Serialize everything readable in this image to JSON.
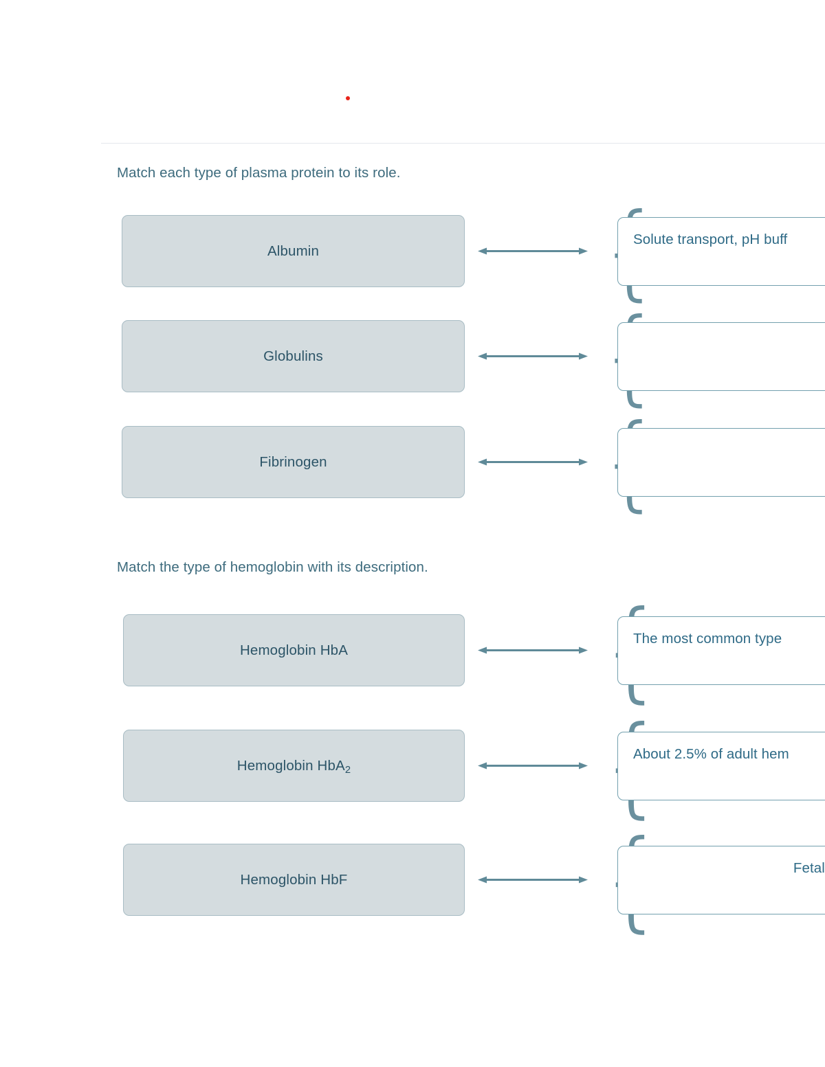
{
  "page": {
    "marker_color": "#e8241a",
    "accent_color": "#73a0ae",
    "tile_fill": "#d4dcdf",
    "text_color": "#2e6a86"
  },
  "sections": [
    {
      "heading": "Match each type of plasma protein to its role.",
      "rows": [
        {
          "term": "Albumin",
          "description": "Solute transport, pH buff",
          "description_align": "left"
        },
        {
          "term": "Globulins",
          "description": "",
          "description_align": "left"
        },
        {
          "term": "Fibrinogen",
          "description": "",
          "description_align": "left"
        }
      ]
    },
    {
      "heading": "Match the type of hemoglobin with its description.",
      "rows": [
        {
          "term": "Hemoglobin HbA",
          "description": "The most common type",
          "description_align": "left"
        },
        {
          "term": "Hemoglobin HbA2",
          "term_base": "Hemoglobin HbA",
          "term_sub": "2",
          "description": "About 2.5% of adult hem",
          "description_align": "left"
        },
        {
          "term": "Hemoglobin HbF",
          "description": "Fetal hemoglobin; conta\nch",
          "description_align": "right"
        }
      ]
    }
  ]
}
